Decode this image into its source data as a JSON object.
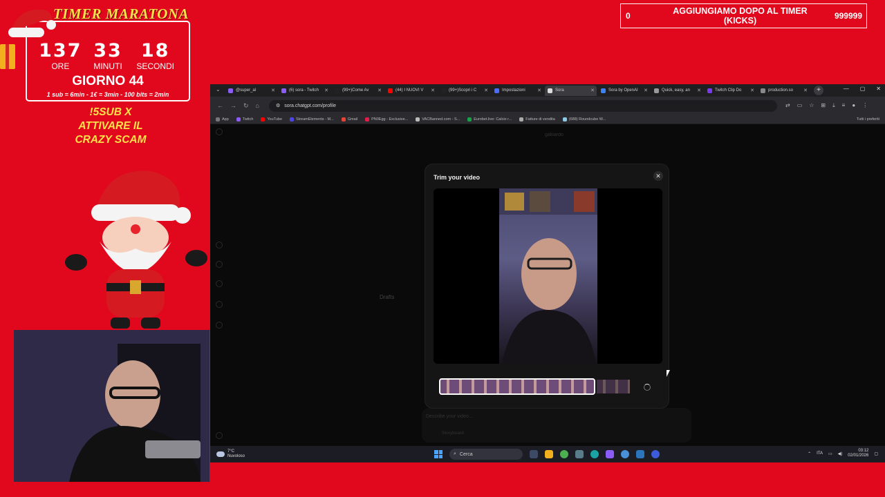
{
  "overlay": {
    "timer_title": "TIMER MARATONA",
    "hours": "137",
    "minutes": "33",
    "seconds": "18",
    "hours_label": "ORE",
    "minutes_label": "MINUTI",
    "seconds_label": "SECONDI",
    "day": "GIORNO 44",
    "rules": "1 sub = 6min - 1€ = 3min - 100 bits = 2min",
    "cta_line1": "!5SUB X",
    "cta_line2": "ATTIVARE IL",
    "cta_line3": "CRAZY SCAM",
    "kicks_left": "0",
    "kicks_text": "AGGIUNGIAMO DOPO AL TIMER (KICKS)",
    "kicks_right": "999999"
  },
  "browser": {
    "tabs": [
      {
        "label": "@super_al",
        "color": "#8b5cf6"
      },
      {
        "label": "(6) sora - Twitch",
        "color": "#8b5cf6"
      },
      {
        "label": "(99+)Come Av",
        "color": "#222222"
      },
      {
        "label": "(44) I NUOVI V",
        "color": "#ff0000"
      },
      {
        "label": "(99+)Scopri i C",
        "color": "#222222"
      },
      {
        "label": "Impostazioni",
        "color": "#4a6cff"
      },
      {
        "label": "Sora",
        "color": "#dddddd",
        "active": true
      },
      {
        "label": "Sora by OpenAI",
        "color": "#3b82f6"
      },
      {
        "label": "Quick, easy, an",
        "color": "#999999"
      },
      {
        "label": "Twitch Clip Do",
        "color": "#7c3aed"
      },
      {
        "label": "production.so",
        "color": "#888888"
      }
    ],
    "url": "sora.chatgpt.com/profile",
    "bookmarks": [
      {
        "label": "App",
        "color": "#777777"
      },
      {
        "label": "Twitch",
        "color": "#8b5cf6"
      },
      {
        "label": "YouTube",
        "color": "#ff0000"
      },
      {
        "label": "StreamElements - M...",
        "color": "#4f46e5"
      },
      {
        "label": "Gmail",
        "color": "#ea4335"
      },
      {
        "label": "PN0Egg - Exclusive...",
        "color": "#e11d48"
      },
      {
        "label": "VACBanned.com - S...",
        "color": "#bbbbbb"
      },
      {
        "label": "Eurobet.live: Calcio r...",
        "color": "#16a34a"
      },
      {
        "label": "Fatture di vendita",
        "color": "#aaaaaa"
      },
      {
        "label": "(688) Roundcube W...",
        "color": "#8ecae6"
      }
    ],
    "bookmarks_all": "Tutti i preferiti"
  },
  "page": {
    "username": "gakiardo",
    "drafts": "Drafts",
    "prompt_placeholder": "Describe your video...",
    "storyboard": "Storyboard"
  },
  "modal": {
    "title": "Trim your video",
    "close": "✕"
  },
  "taskbar": {
    "temp": "7°C",
    "weather": "Nuvoloso",
    "search": "Cerca",
    "lang": "ITA",
    "time": "03:12",
    "date": "02/01/2026"
  }
}
